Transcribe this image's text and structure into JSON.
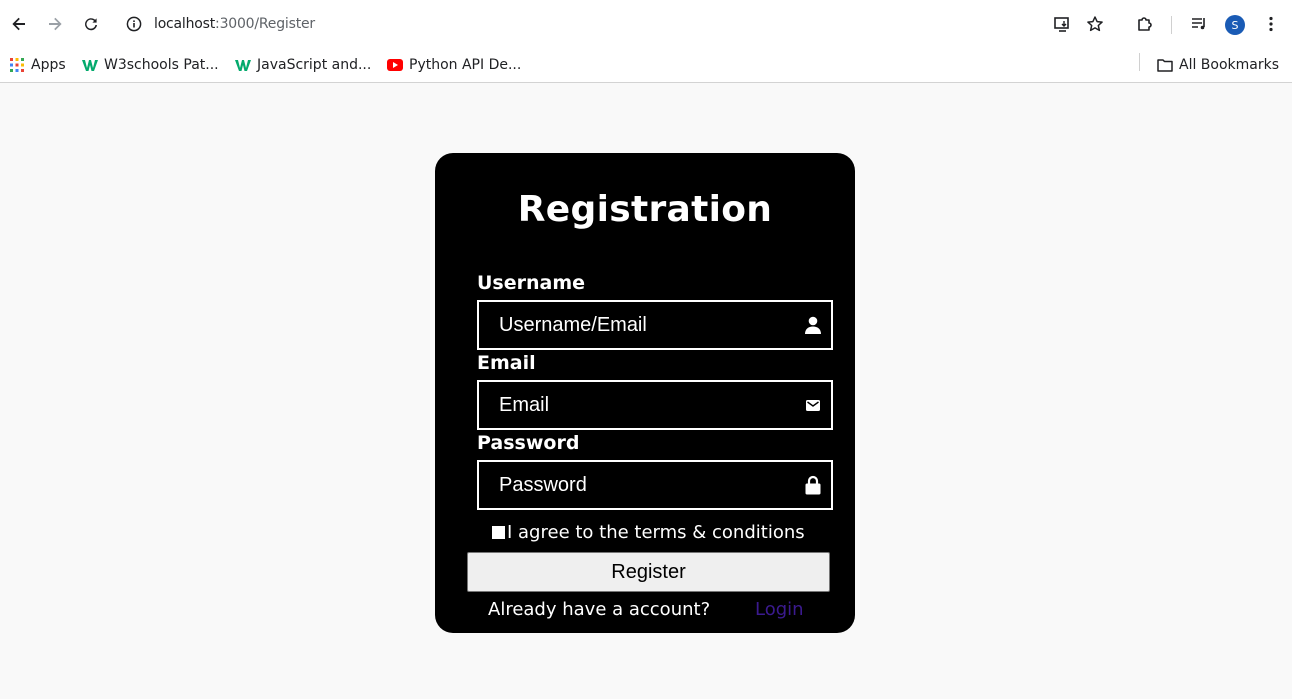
{
  "browser": {
    "url_host": "localhost",
    "url_path": ":3000/Register",
    "avatar_initial": "S",
    "bookmarks": [
      {
        "label": "Apps",
        "icon": "apps-grid-icon"
      },
      {
        "label": "W3schools Pat...",
        "icon": "w3schools-icon"
      },
      {
        "label": "JavaScript and...",
        "icon": "w3schools-icon"
      },
      {
        "label": "Python API De...",
        "icon": "youtube-icon"
      }
    ],
    "all_bookmarks_label": "All Bookmarks"
  },
  "form": {
    "title": "Registration",
    "username": {
      "label": "Username",
      "placeholder": "Username/Email",
      "value": ""
    },
    "email": {
      "label": "Email",
      "placeholder": "Email",
      "value": ""
    },
    "password": {
      "label": "Password",
      "placeholder": "Password",
      "value": ""
    },
    "terms_label": "I agree to the terms & conditions",
    "terms_checked": false,
    "register_label": "Register",
    "footer_text": "Already have a account?",
    "login_label": "Login"
  },
  "colors": {
    "page_bg": "#f9f9f9",
    "card_bg": "#000000",
    "login_link": "#3b1a8f"
  }
}
